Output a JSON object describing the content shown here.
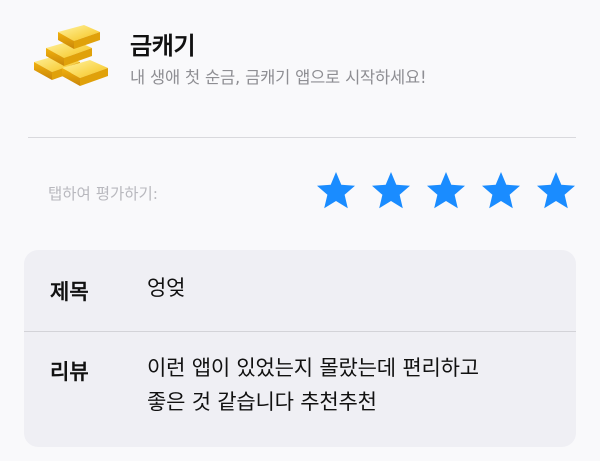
{
  "app": {
    "icon": "gold-bars-icon",
    "name": "금캐기",
    "subtitle": "내 생애 첫 순금, 금캐기 앱으로 시작하세요!"
  },
  "rating": {
    "label": "탭하여 평가하기:",
    "value": 5,
    "max": 5,
    "star_color": "#1a8cff"
  },
  "review": {
    "title_label": "제목",
    "title_value": "엉엊",
    "review_label": "리뷰",
    "review_lines": [
      "이런 앱이 있었는지 몰랐는데 편리하고",
      "좋은 것 같습니다 추천추천"
    ]
  }
}
